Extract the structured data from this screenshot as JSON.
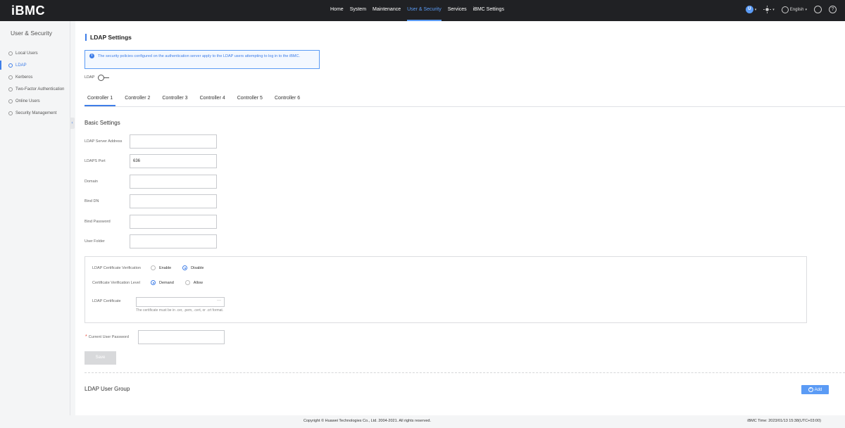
{
  "header": {
    "logo": "iBMC",
    "nav": [
      "Home",
      "System",
      "Maintenance",
      "User & Security",
      "Services",
      "iBMC Settings"
    ],
    "active_nav": "User & Security",
    "language": "English",
    "user_initial": "U"
  },
  "sidebar": {
    "title": "User & Security",
    "items": [
      {
        "label": "Local Users",
        "icon": "user-icon"
      },
      {
        "label": "LDAP",
        "icon": "ldap-icon"
      },
      {
        "label": "Kerberos",
        "icon": "shield-icon"
      },
      {
        "label": "Two-Factor Authentication",
        "icon": "user-icon"
      },
      {
        "label": "Online Users",
        "icon": "user-icon"
      },
      {
        "label": "Security Management",
        "icon": "gear-icon"
      }
    ],
    "active_item": "LDAP",
    "collapse_glyph": "‹"
  },
  "page": {
    "title": "LDAP Settings",
    "notice": "The security policies configured on the authentication server apply to the LDAP users attempting to log in to the iBMC.",
    "ldap_toggle_label": "LDAP",
    "ldap_enabled": false,
    "tabs": [
      "Controller 1",
      "Controller 2",
      "Controller 3",
      "Controller 4",
      "Controller 5",
      "Controller 6"
    ],
    "active_tab": "Controller 1",
    "basic_settings": {
      "title": "Basic Settings",
      "fields": [
        {
          "label": "LDAP Server Address",
          "value": ""
        },
        {
          "label": "LDAPS Port",
          "value": "636"
        },
        {
          "label": "Domain",
          "value": ""
        },
        {
          "label": "Bind DN",
          "value": ""
        },
        {
          "label": "Bind Password",
          "value": ""
        },
        {
          "label": "User Folder",
          "value": ""
        }
      ]
    },
    "certificate": {
      "verification_label": "LDAP Certificate Verification",
      "verification_options": [
        "Enable",
        "Disable"
      ],
      "verification_selected": "Disable",
      "level_label": "Certificate Verification Level",
      "level_options": [
        "Demand",
        "Allow"
      ],
      "level_selected": "Demand",
      "cert_label": "LDAP Certificate",
      "cert_value": "",
      "cert_browse": "···",
      "cert_hint": "The certificate must be in .cer, .pem, .cert, or .crt format."
    },
    "current_password_label": "Current User Password",
    "current_password_required": "*",
    "save_label": "Save",
    "user_group_title": "LDAP User Group",
    "add_label": "Add"
  },
  "footer": {
    "copyright": "Copyright © Huawei Technologies Co., Ltd. 2004-2021. All rights reserved.",
    "ibmc_time": "iBMC Time: 2023/01/13 15:38(UTC+03:00)"
  },
  "colors": {
    "accent": "#3f7ee8",
    "topbar": "#202124",
    "notice_bg": "#f3f8ff"
  }
}
